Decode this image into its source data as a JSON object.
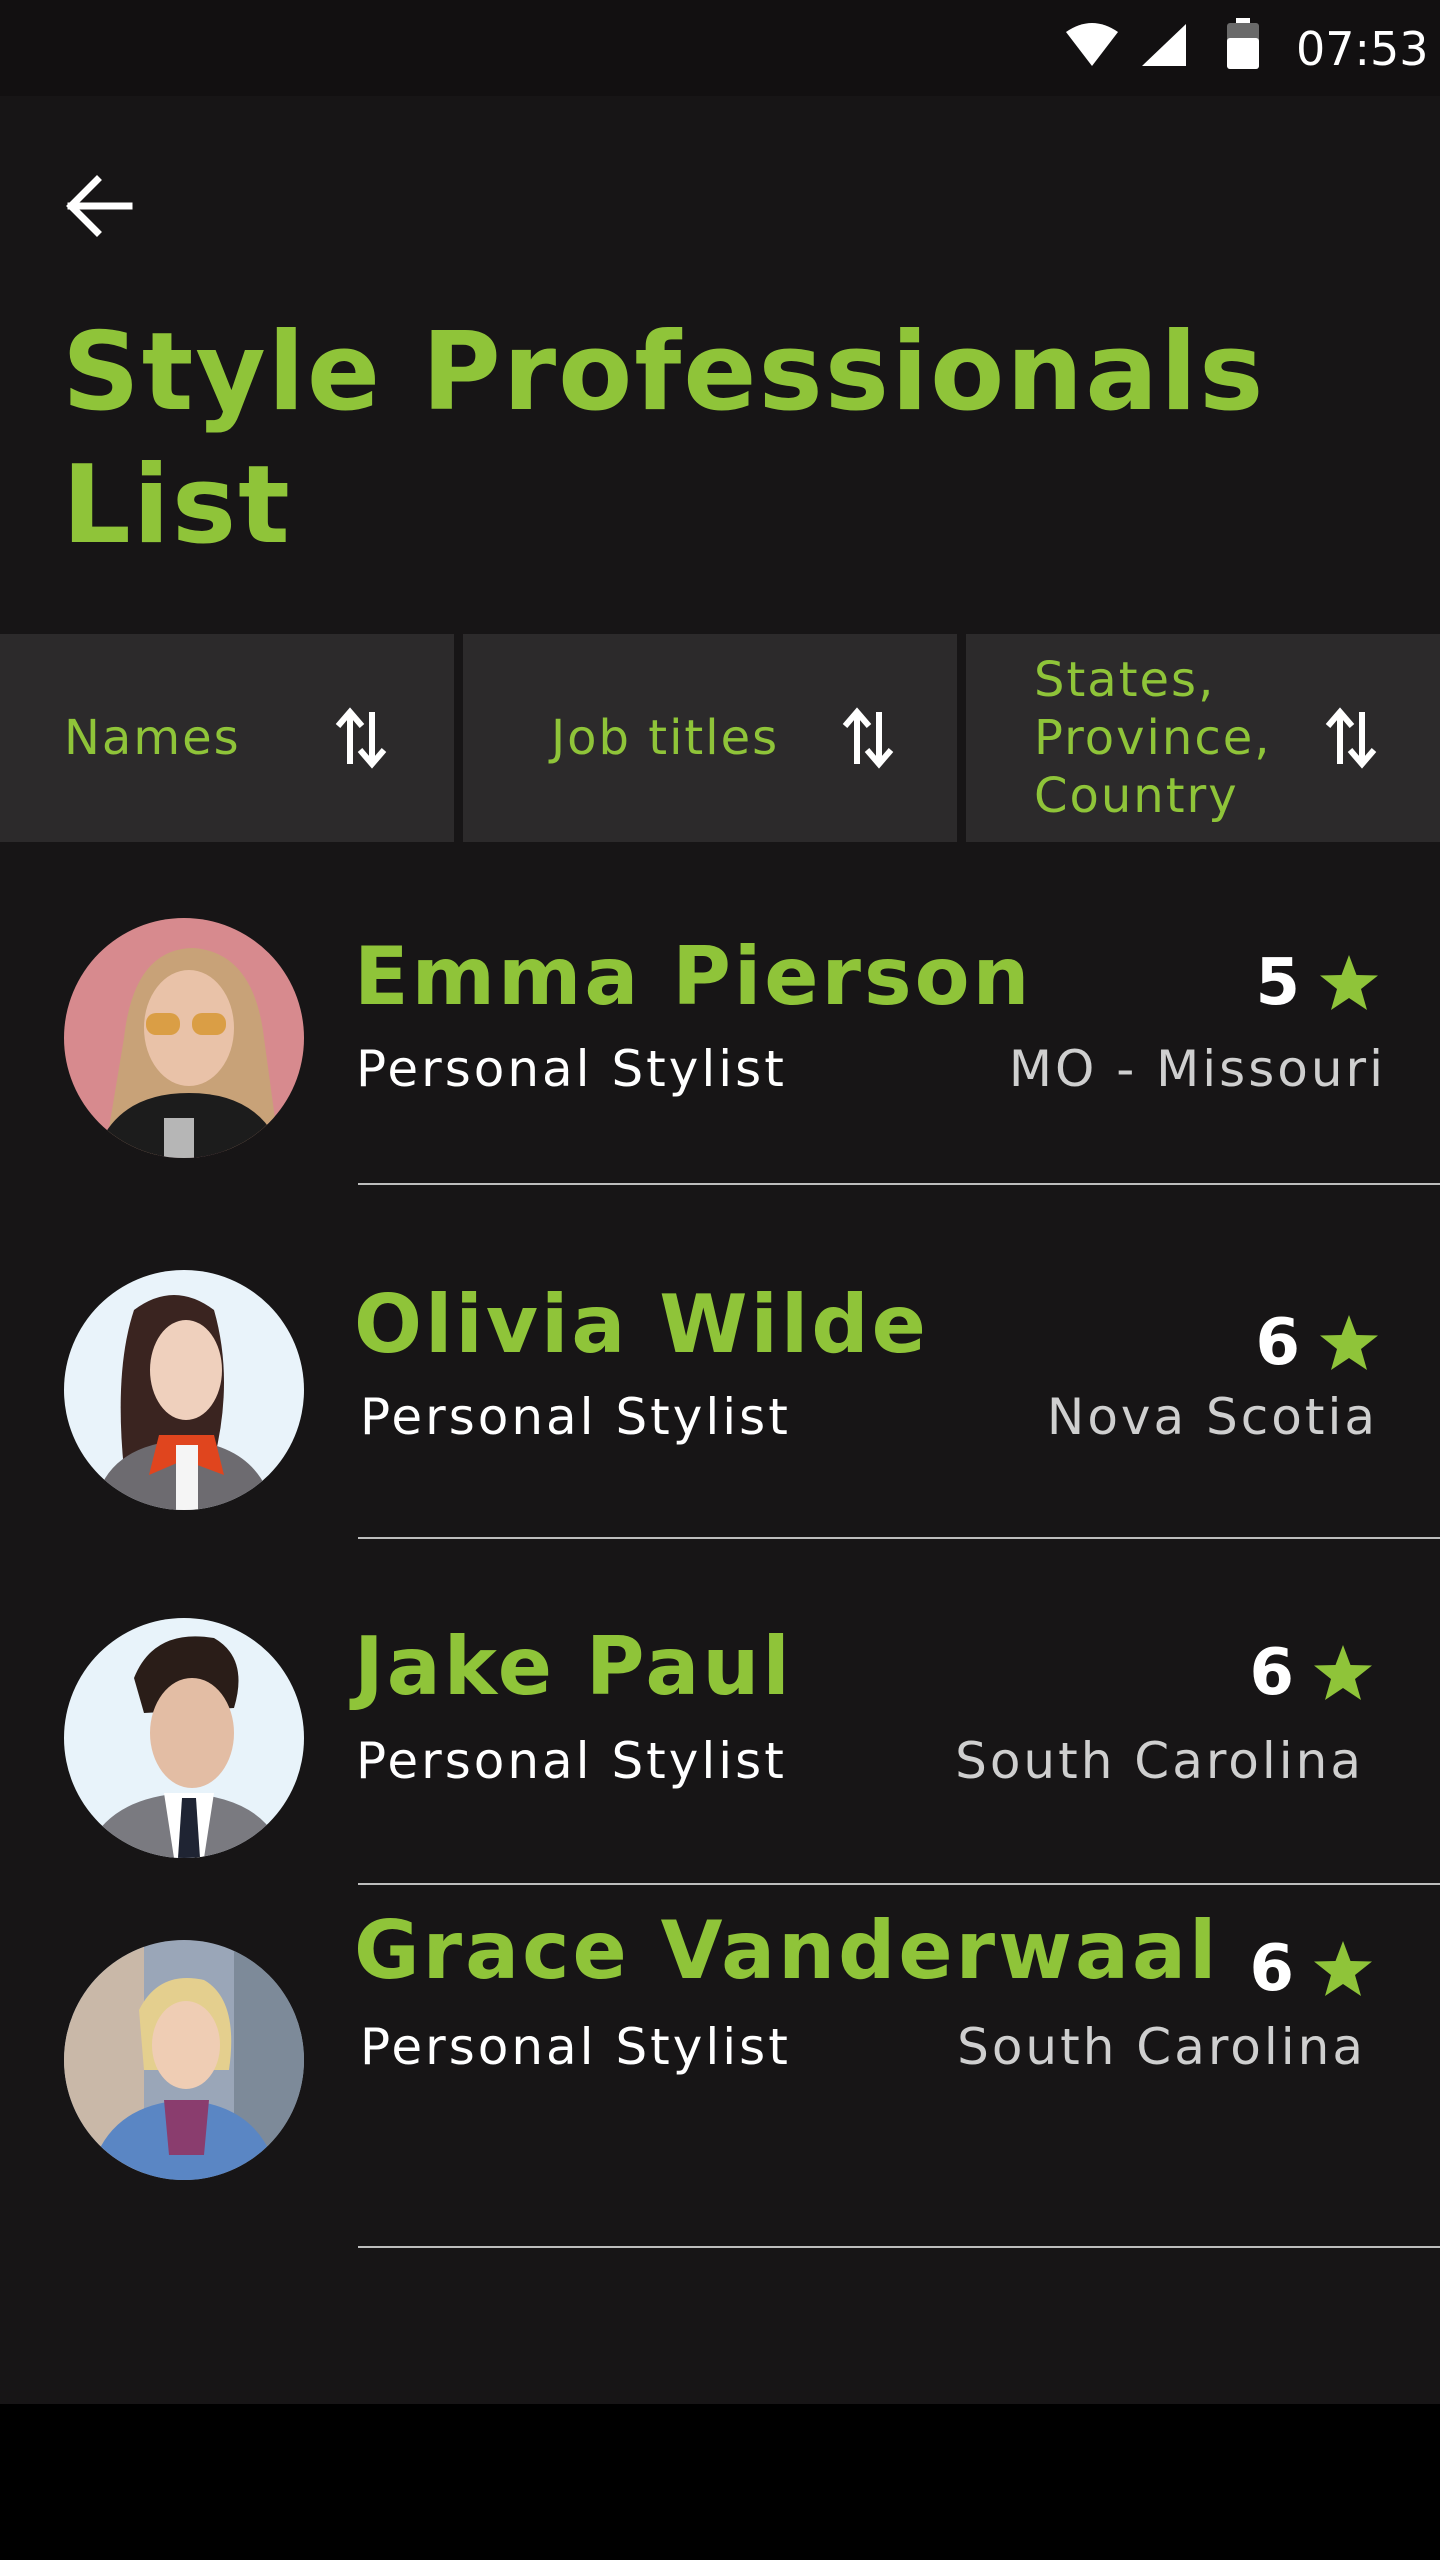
{
  "status_bar": {
    "time": "07:53",
    "icons": [
      "wifi-icon",
      "signal-icon",
      "battery-icon"
    ]
  },
  "header": {
    "back_icon": "arrow-left-icon",
    "title": "Style Professionals List"
  },
  "sort_bar": {
    "columns": [
      {
        "label": "Names",
        "icon": "sort-arrows-icon"
      },
      {
        "label": "Job titles",
        "icon": "sort-arrows-icon"
      },
      {
        "label": "States, Province, Country",
        "icon": "sort-arrows-icon"
      }
    ]
  },
  "professionals": [
    {
      "name": "Emma Pierson",
      "job": "Personal Stylist",
      "rating": "5",
      "region": "MO - Missouri"
    },
    {
      "name": "Olivia Wilde",
      "job": "Personal Stylist",
      "rating": "6",
      "region": "Nova Scotia"
    },
    {
      "name": "Jake Paul",
      "job": "Personal Stylist",
      "rating": "6",
      "region": "South Carolina"
    },
    {
      "name": "Grace Vanderwaal",
      "job": "Personal Stylist",
      "rating": "6",
      "region": "South Carolina"
    }
  ],
  "colors": {
    "accent": "#8fc439",
    "background": "#171516",
    "sort_bar": "#2c2a2b",
    "text_primary": "#ffffff",
    "text_secondary": "#cfcfcf"
  }
}
